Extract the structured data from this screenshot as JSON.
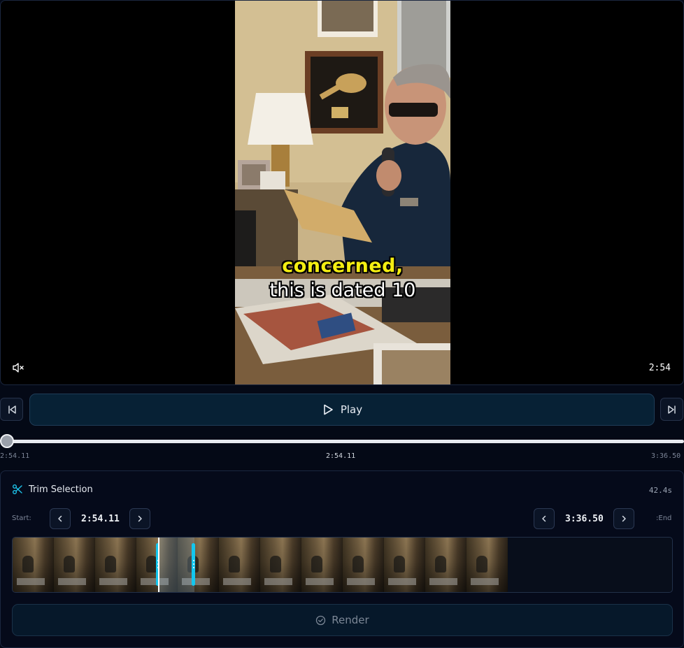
{
  "video": {
    "caption_highlight": "concerned,",
    "caption_line": "this is dated 10",
    "current_time_badge": "2:54",
    "muted": true,
    "icons": {
      "mute": "volume-muted-icon"
    }
  },
  "controls": {
    "play_label": "Play",
    "prev_icon": "skip-back-icon",
    "next_icon": "skip-forward-icon",
    "play_icon": "play-icon"
  },
  "seek": {
    "start_label": "2:54.11",
    "current_label": "2:54.11",
    "end_label": "3:36.50",
    "progress_fraction": 0.0
  },
  "trim": {
    "title": "Trim Selection",
    "icon": "scissors-icon",
    "duration": "42.4s",
    "start_label": "Start:",
    "start_value": "2:54.11",
    "end_value": "3:36.50",
    "end_label": ":End",
    "render_label": "Render",
    "render_icon": "check-circle-icon",
    "accent_color": "#13c7ef"
  }
}
